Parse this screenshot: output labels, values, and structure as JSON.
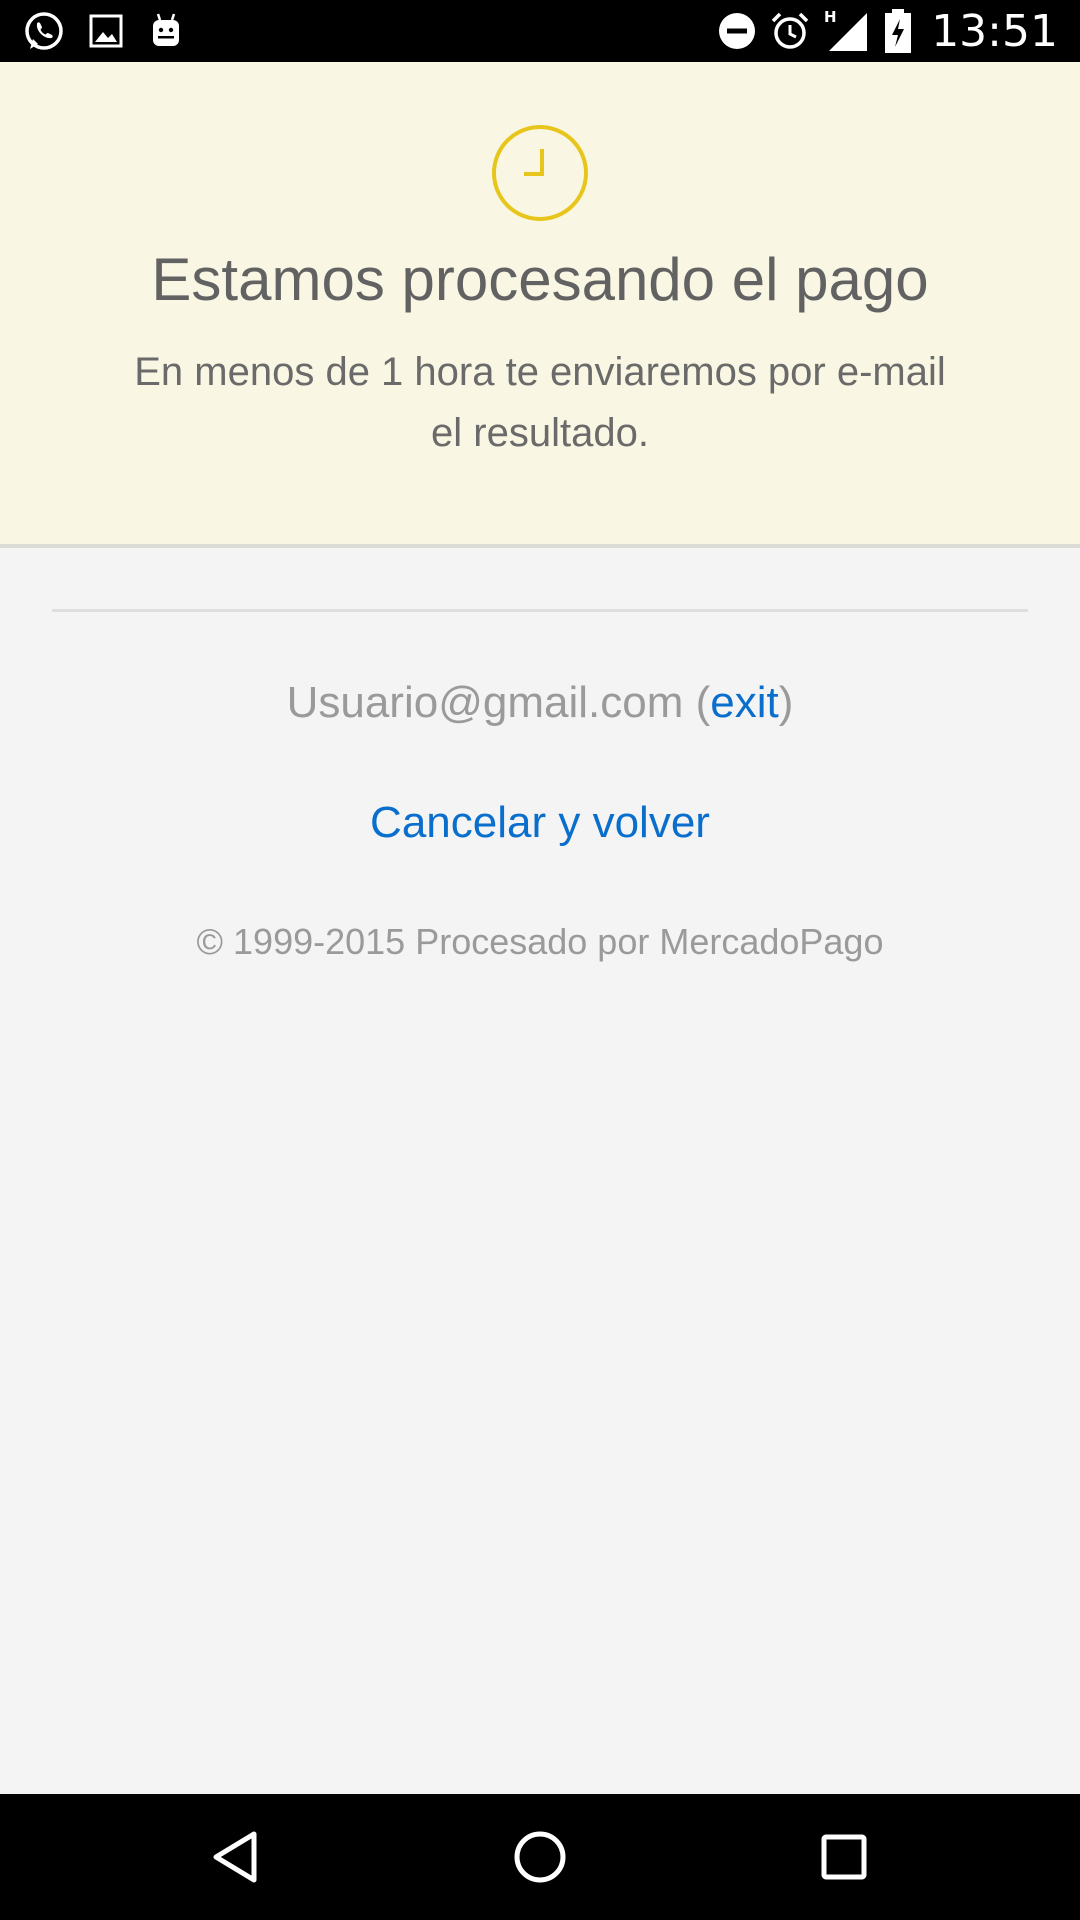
{
  "status_bar": {
    "time": "13:51",
    "network_type": "H",
    "left_icons": [
      "whatsapp-icon",
      "image-icon",
      "android-icon"
    ],
    "right_icons": [
      "do-not-disturb-icon",
      "alarm-icon",
      "signal-icon",
      "battery-charging-icon"
    ]
  },
  "banner": {
    "icon": "clock-icon",
    "accent_color": "#e8c51a",
    "background_color": "#f9f7e3",
    "title": "Estamos procesando el pago",
    "subtitle": "En menos de 1 hora te enviaremos por e-mail el resultado."
  },
  "account": {
    "email": "Usuario@gmail.com",
    "open_paren": " (",
    "exit_label": "exit",
    "close_paren": ")"
  },
  "actions": {
    "cancel_label": "Cancelar y volver"
  },
  "footer": {
    "text": "© 1999-2015 Procesado por MercadoPago"
  },
  "nav_bar": {
    "buttons": [
      "back-icon",
      "home-icon",
      "recents-icon"
    ]
  },
  "colors": {
    "link": "#0a6ecd",
    "muted_text": "#9a9a9a",
    "title_text": "#626262"
  }
}
